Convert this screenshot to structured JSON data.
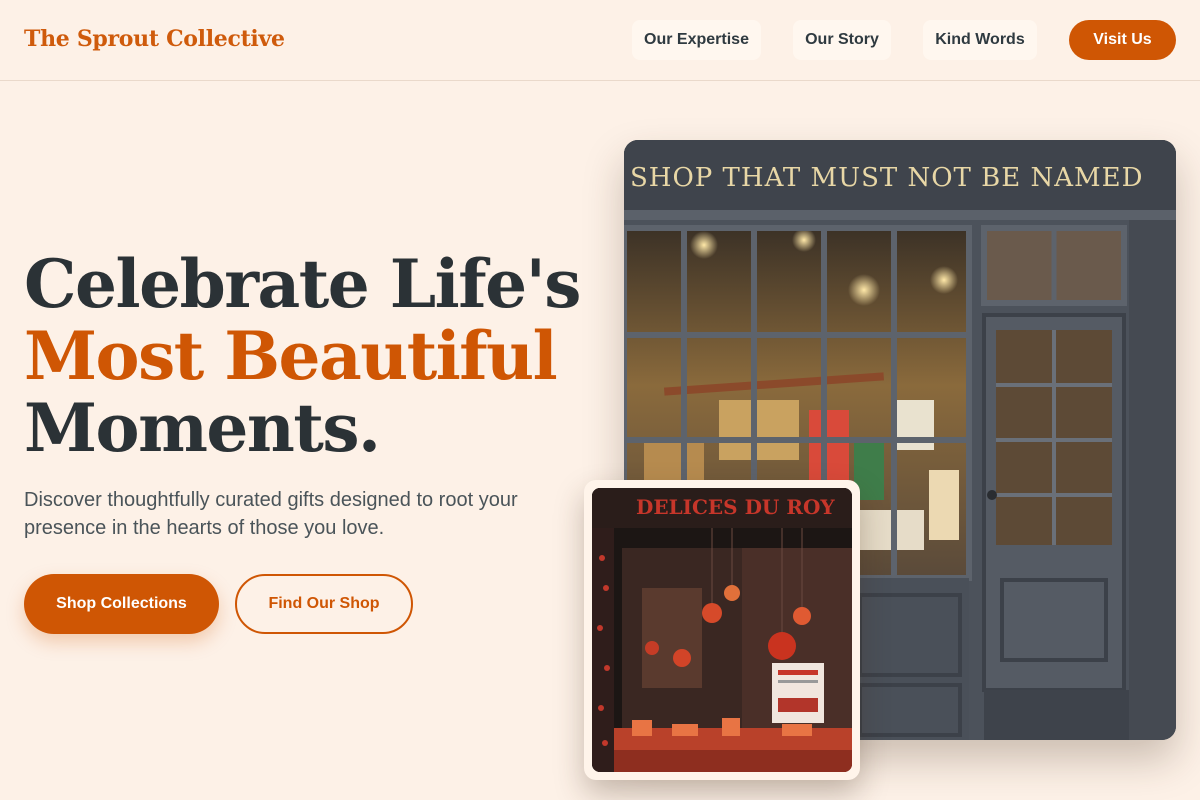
{
  "header": {
    "brand": "The Sprout Collective",
    "nav": [
      {
        "label": "Our Expertise"
      },
      {
        "label": "Our Story"
      },
      {
        "label": "Kind Words"
      }
    ],
    "cta_label": "Visit Us"
  },
  "hero": {
    "title_line1": "Celebrate Life's",
    "title_line2": "Most Beautiful",
    "title_line3": "Moments.",
    "subtitle": "Discover thoughtfully curated gifts designed to root your presence in the hearts of those you love.",
    "primary_button": "Shop Collections",
    "secondary_button": "Find Our Shop"
  },
  "images": {
    "main_sign": "SHOP THAT MUST NOT BE NAMED",
    "card_sign": "DELICES DU ROY"
  },
  "colors": {
    "background": "#fdf1e7",
    "accent": "#cf5604",
    "text_dark": "#2b3236"
  }
}
